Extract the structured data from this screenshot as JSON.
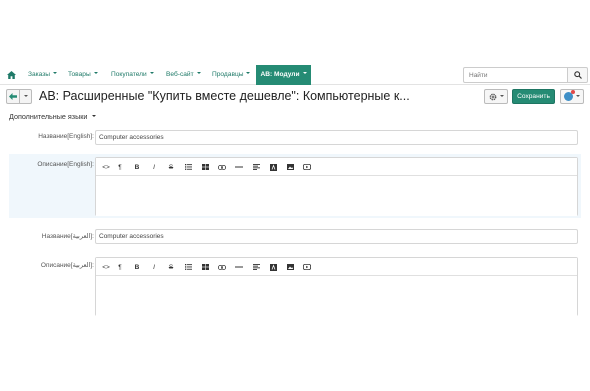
{
  "nav": {
    "items": [
      {
        "label": "Заказы"
      },
      {
        "label": "Товары"
      },
      {
        "label": "Покупатели"
      },
      {
        "label": "Веб-сайт"
      },
      {
        "label": "Продавцы"
      }
    ],
    "active": {
      "label": "AB: Модули"
    },
    "search_placeholder": "Найти"
  },
  "header": {
    "title": "AB: Расширенные \"Купить вместе дешевле\": Компьютерные к...",
    "save_label": "Сохранить"
  },
  "content": {
    "section_title": "Дополнительные языки",
    "fields": {
      "name_en_label": "Название[English]:",
      "name_en_value": "Computer accessories",
      "desc_en_label": "Описание[English]:",
      "name_ar_label": "Название[العربية]:",
      "name_ar_value": "Computer accessories",
      "desc_ar_label": "Описание[العربية]:"
    },
    "toolbar_labels": {
      "code": "<>",
      "paragraph": "¶",
      "bold": "B",
      "italic": "I",
      "strike": "S"
    }
  },
  "colors": {
    "accent": "#258b74",
    "link": "#1f7a68",
    "description_background": "#f0f7fc"
  }
}
